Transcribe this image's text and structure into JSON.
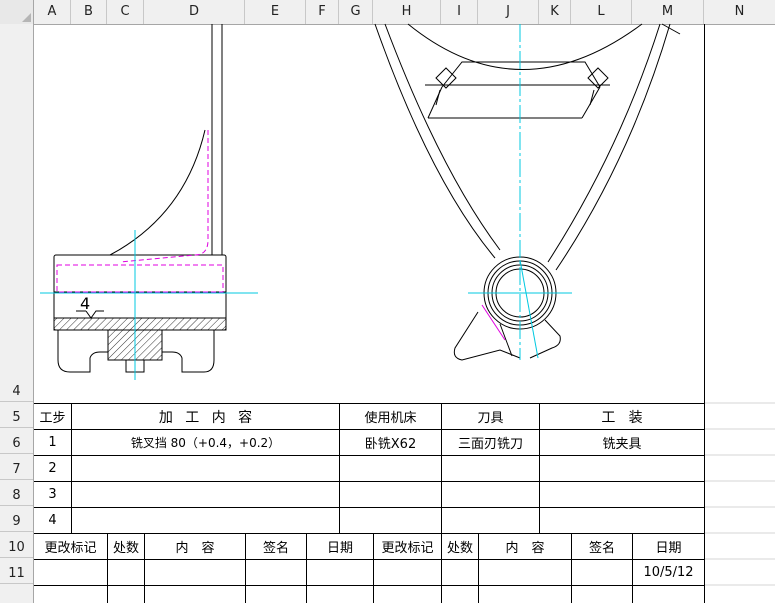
{
  "columns": [
    "A",
    "B",
    "C",
    "D",
    "E",
    "F",
    "G",
    "H",
    "I",
    "J",
    "K",
    "L",
    "M",
    "N"
  ],
  "rows": [
    "4",
    "5",
    "6",
    "7",
    "8",
    "9",
    "10",
    "11"
  ],
  "drawing": {
    "dimension_label": "4"
  },
  "table": {
    "header": {
      "step": "工步",
      "content": "加 工 内 容",
      "machine": "使用机床",
      "tool": "刀具",
      "fixture": "工   装"
    },
    "rows": [
      {
        "step": "1",
        "content": "铣叉挡 80（+0.4，+0.2）",
        "machine": "卧铣X62",
        "tool": "三面刃铣刀",
        "fixture": "铣夹具"
      },
      {
        "step": "2",
        "content": "",
        "machine": "",
        "tool": "",
        "fixture": ""
      },
      {
        "step": "3",
        "content": "",
        "machine": "",
        "tool": "",
        "fixture": ""
      },
      {
        "step": "4",
        "content": "",
        "machine": "",
        "tool": "",
        "fixture": ""
      }
    ],
    "revision_header": [
      "更改标记",
      "处数",
      "内　容",
      "签名",
      "日期",
      "更改标记",
      "处数",
      "内　容",
      "签名",
      "日期"
    ],
    "revision_row": [
      "",
      "",
      "",
      "",
      "",
      "",
      "",
      "",
      "",
      "10/5/12"
    ]
  }
}
